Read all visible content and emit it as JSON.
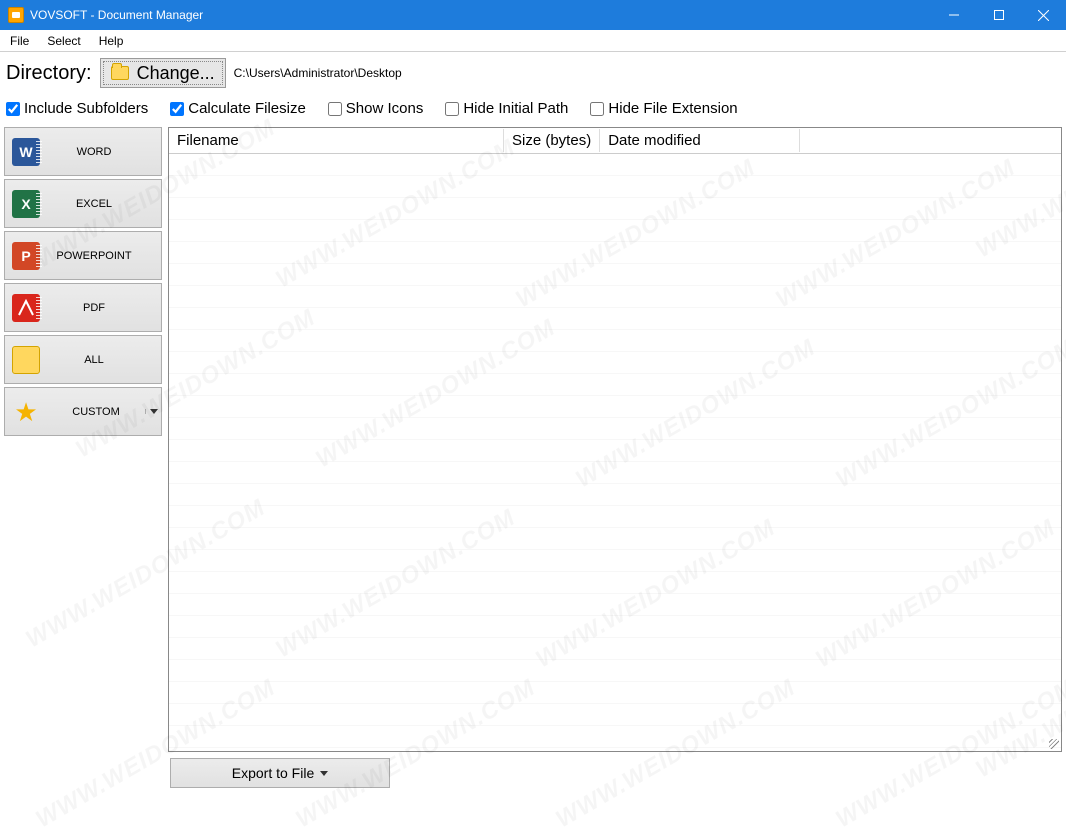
{
  "window": {
    "title": "VOVSOFT - Document Manager"
  },
  "menu": {
    "file": "File",
    "select": "Select",
    "help": "Help"
  },
  "directory": {
    "label": "Directory:",
    "change_label": "Change...",
    "path": "C:\\Users\\Administrator\\Desktop"
  },
  "options": {
    "include_subfolders": {
      "label": "Include Subfolders",
      "checked": true
    },
    "calculate_filesize": {
      "label": "Calculate Filesize",
      "checked": true
    },
    "show_icons": {
      "label": "Show Icons",
      "checked": false
    },
    "hide_initial_path": {
      "label": "Hide Initial Path",
      "checked": false
    },
    "hide_file_ext": {
      "label": "Hide File Extension",
      "checked": false
    }
  },
  "sidebar": {
    "word": {
      "label": "WORD",
      "glyph": "W"
    },
    "excel": {
      "label": "EXCEL",
      "glyph": "X"
    },
    "ppt": {
      "label": "POWERPOINT",
      "glyph": "P"
    },
    "pdf": {
      "label": "PDF",
      "glyph": ""
    },
    "all": {
      "label": "ALL"
    },
    "custom": {
      "label": "CUSTOM"
    }
  },
  "table": {
    "columns": {
      "filename": "Filename",
      "size": "Size (bytes)",
      "date": "Date modified"
    },
    "rows": []
  },
  "export": {
    "label": "Export to File"
  },
  "watermark": "WWW.WEIDOWN.COM"
}
